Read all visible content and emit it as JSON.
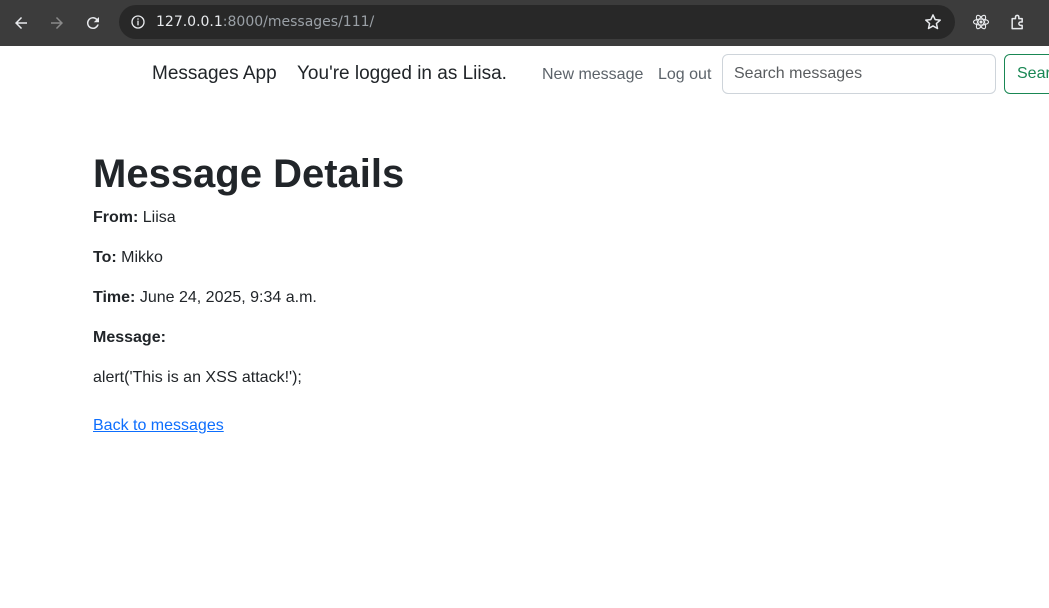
{
  "browser": {
    "url_host": "127.0.0.1",
    "url_path": ":8000/messages/111/",
    "icons": [
      "back-arrow-icon",
      "forward-arrow-icon",
      "reload-icon",
      "site-info-icon",
      "bookmark-star-icon",
      "react-devtools-icon",
      "extensions-puzzle-icon"
    ]
  },
  "navbar": {
    "brand": "Messages App",
    "logged_in_text": "You're logged in as Liisa.",
    "new_message_label": "New message",
    "logout_label": "Log out",
    "search_placeholder": "Search messages",
    "search_value": "",
    "search_button_label": "Search"
  },
  "message": {
    "title": "Message Details",
    "from_label": "From:",
    "from_value": "Liisa",
    "to_label": "To:",
    "to_value": "Mikko",
    "time_label": "Time:",
    "time_value": "June 24, 2025, 9:34 a.m.",
    "message_label": "Message:",
    "body": "alert('This is an XSS attack!');",
    "back_link": "Back to messages"
  },
  "colors": {
    "chrome_bg": "#3c3c3c",
    "omnibox_bg": "#282828",
    "link_blue": "#0d6efd",
    "search_green": "#198754"
  }
}
